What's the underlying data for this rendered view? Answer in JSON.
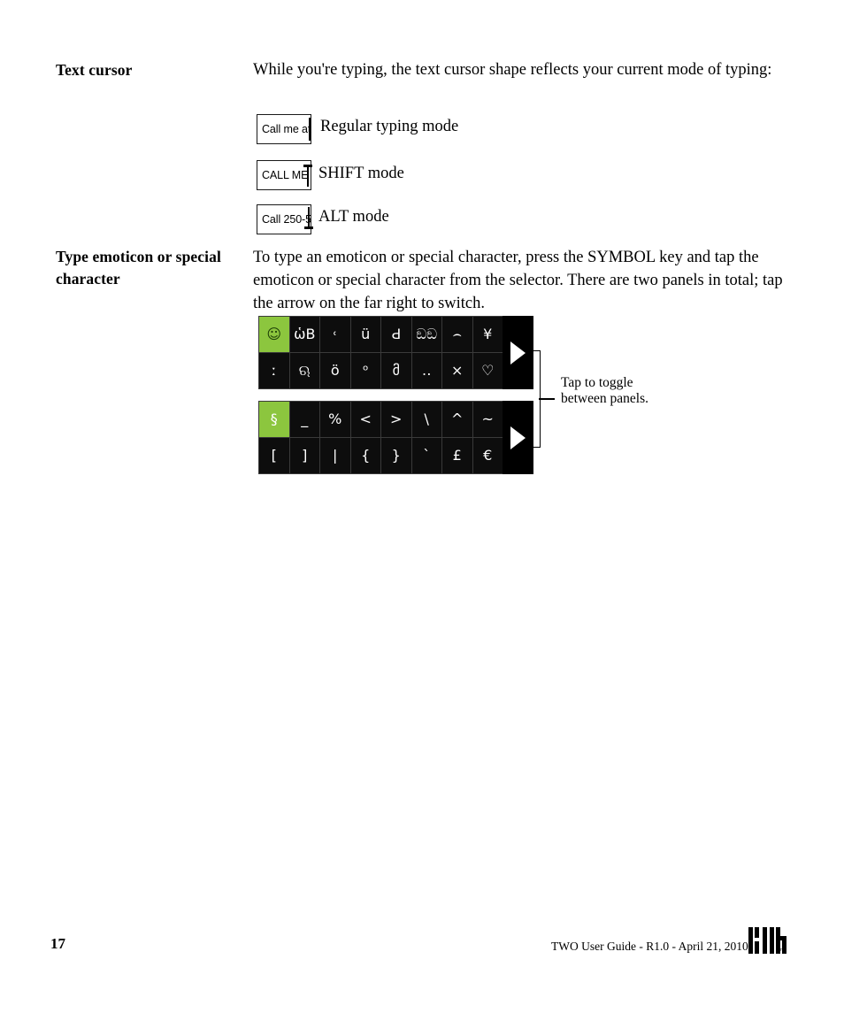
{
  "sections": [
    {
      "label": "Text cursor",
      "paragraph": "While you're typing, the text cursor shape reflects your current mode of typing:",
      "demos": [
        {
          "field_text": "Call me at",
          "caption": "Regular typing mode",
          "cursor": "bar"
        },
        {
          "field_text": "CALL ME",
          "caption": "SHIFT mode",
          "cursor": "up-arrow"
        },
        {
          "field_text": "Call 250-5",
          "caption": "ALT mode",
          "cursor": "down-arrow"
        }
      ]
    },
    {
      "label": "Type emoticon or special character",
      "paragraph": "To type an emoticon or special character, press the SYMBOL key and tap the emoticon or special character from the selector. There are two panels in total; tap the arrow on the far right to switch."
    }
  ],
  "emoticon_panel": {
    "row1": [
      "☺",
      "ὡB",
      "˓",
      "ü",
      "Ԁ",
      "ඞඞ",
      "⌢",
      "¥"
    ],
    "row2": [
      "ː",
      "ଋ",
      "ö",
      "ᵒ",
      "მ",
      "‥",
      "⨯",
      "♡"
    ],
    "arrow": "right-arrow"
  },
  "symbol_panel": {
    "row1": [
      "§",
      "_",
      "%",
      "<",
      ">",
      "\\",
      "^",
      "~"
    ],
    "row2": [
      "[",
      "]",
      "|",
      "{",
      "}",
      "`",
      "£",
      "€"
    ],
    "arrow": "right-arrow"
  },
  "callout": {
    "line1": "Tap to toggle",
    "line2": "between panels."
  },
  "footer": {
    "page_number": "17",
    "text": "TWO User Guide - R1.0 - April 21, 2010",
    "logo": "kin-logo",
    "trademark": "™"
  },
  "colors": {
    "accent_green": "#8CC63E",
    "key_background": "#0d0d0d",
    "panel_background": "#000000"
  }
}
